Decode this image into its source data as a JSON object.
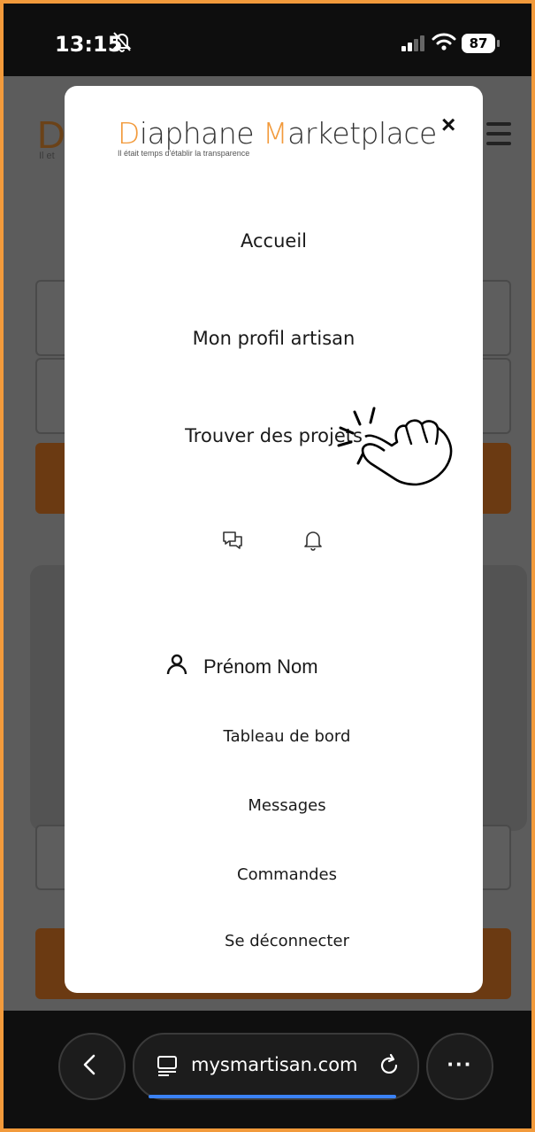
{
  "status_bar": {
    "time": "13:15",
    "battery": "87"
  },
  "background": {
    "letter": "D",
    "tagline_fragment": "Il et"
  },
  "modal": {
    "logo_first_letter": "D",
    "logo_part1": "iaphane ",
    "logo_second_letter": "M",
    "logo_part2": "arketplace",
    "tagline": "Il était temps d'établir la transparence",
    "close_label": "×",
    "menu": [
      {
        "label": "Accueil"
      },
      {
        "label": "Mon profil artisan"
      },
      {
        "label": "Trouver des projets"
      }
    ],
    "icons": [
      "chat-icon",
      "bell-icon"
    ],
    "user": {
      "name": "Prénom Nom",
      "icon": "user-icon"
    },
    "submenu": [
      {
        "label": "Tableau de bord"
      },
      {
        "label": "Messages"
      },
      {
        "label": "Commandes"
      },
      {
        "label": "Se déconnecter"
      }
    ]
  },
  "browser": {
    "url": "mysmartisan.com",
    "more_label": "···"
  },
  "colors": {
    "accent": "#f29a3b",
    "progress": "#3b82f6"
  }
}
